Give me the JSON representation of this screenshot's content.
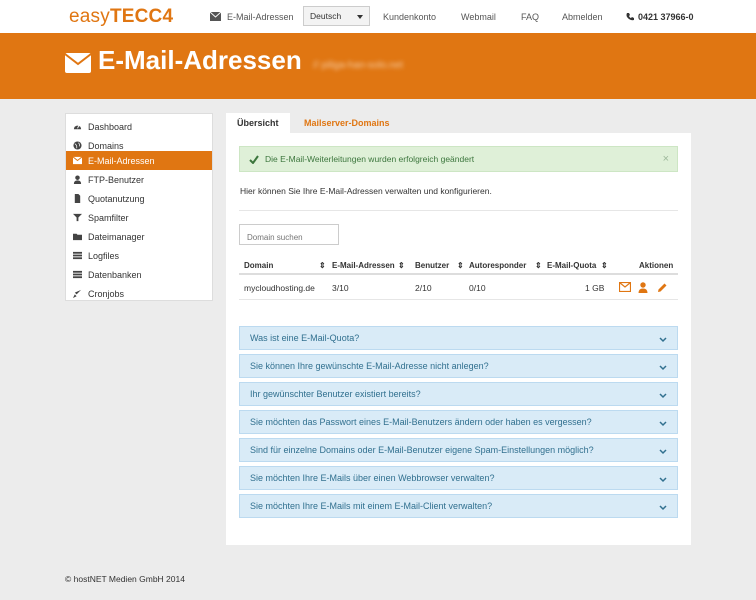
{
  "brand": {
    "logo_plain": "easy",
    "logo_bold": "TECC4",
    "accent": "#e07612"
  },
  "topnav": {
    "email_link": "E-Mail-Adressen",
    "language": "Deutsch",
    "account": "Kundenkonto",
    "webmail": "Webmail",
    "faq": "FAQ",
    "logout": "Abmelden",
    "phone": "0421 37966-0"
  },
  "header": {
    "title": "E-Mail-Adressen",
    "domain": "// piliga-han-solo.net"
  },
  "sidebar": {
    "items": [
      {
        "label": "Dashboard",
        "icon": "dashboard-icon"
      },
      {
        "label": "Domains",
        "icon": "globe-icon"
      },
      {
        "label": "E-Mail-Adressen",
        "icon": "envelope-icon",
        "active": true
      },
      {
        "label": "FTP-Benutzer",
        "icon": "user-icon"
      },
      {
        "label": "Quotanutzung",
        "icon": "file-icon"
      },
      {
        "label": "Spamfilter",
        "icon": "filter-icon"
      },
      {
        "label": "Dateimanager",
        "icon": "folder-icon"
      },
      {
        "label": "Logfiles",
        "icon": "list-icon"
      },
      {
        "label": "Datenbanken",
        "icon": "database-icon"
      },
      {
        "label": "Cronjobs",
        "icon": "rocket-icon"
      }
    ]
  },
  "tabs": {
    "overview": "Übersicht",
    "mailserver": "Mailserver-Domains"
  },
  "alert": {
    "message": "Die E-Mail-Weiterleitungen wurden erfolgreich geändert",
    "close": "×"
  },
  "intro": "Hier können Sie Ihre E-Mail-Adressen verwalten und konfigurieren.",
  "search": {
    "placeholder": "Domain suchen"
  },
  "table": {
    "columns": [
      "Domain",
      "E-Mail-Adressen",
      "Benutzer",
      "Autoresponder",
      "E-Mail-Quota",
      "Aktionen"
    ],
    "sort_glyph": "⇕",
    "rows": [
      {
        "domain": "mycloudhosting.de",
        "emails": "3/10",
        "users": "2/10",
        "autoresponder": "0/10",
        "quota": "1 GB"
      }
    ]
  },
  "faq": [
    "Was ist eine E-Mail-Quota?",
    "Sie können Ihre gewünschte E-Mail-Adresse nicht anlegen?",
    "Ihr gewünschter Benutzer existiert bereits?",
    "Sie möchten das Passwort eines E-Mail-Benutzers ändern oder haben es vergessen?",
    "Sind für einzelne Domains oder E-Mail-Benutzer eigene Spam-Einstellungen möglich?",
    "Sie möchten Ihre E-Mails über einen Webbrowser verwalten?",
    "Sie möchten Ihre E-Mails mit einem E-Mail-Client verwalten?"
  ],
  "footer": "© hostNET Medien GmbH 2014"
}
